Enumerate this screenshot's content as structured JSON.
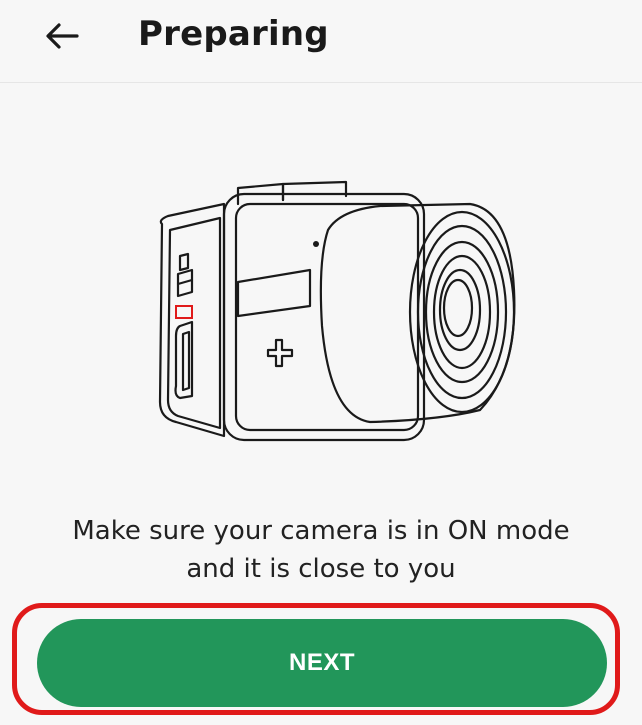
{
  "header": {
    "back_icon": "arrow-left-icon",
    "title": "Preparing"
  },
  "illustration": {
    "icon": "camera-icon"
  },
  "main": {
    "message": "Make sure your camera is in ON mode and it is close to you"
  },
  "footer": {
    "next_label": "NEXT"
  },
  "colors": {
    "accent": "#22965a",
    "highlight": "#e01a1a",
    "background": "#f7f7f7",
    "text": "#1a1a1a"
  }
}
